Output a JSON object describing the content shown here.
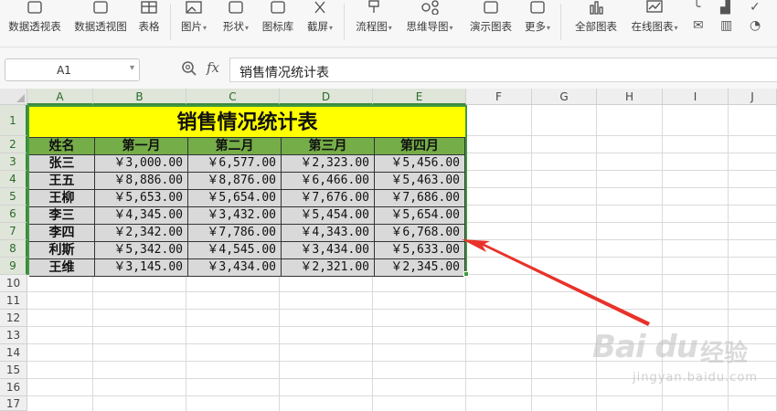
{
  "ribbon": {
    "items": [
      {
        "label": "数据透视表",
        "icon": "pivot-table-icon"
      },
      {
        "label": "数据透视图",
        "icon": "pivot-chart-icon"
      },
      {
        "label": "表格",
        "icon": "table-icon"
      },
      {
        "label": "图片",
        "icon": "picture-icon"
      },
      {
        "label": "形状",
        "icon": "shape-icon"
      },
      {
        "label": "图标库",
        "icon": "icon-library-icon"
      },
      {
        "label": "截屏",
        "icon": "screenshot-icon"
      },
      {
        "label": "流程图",
        "icon": "flowchart-icon"
      },
      {
        "label": "思维导图",
        "icon": "mindmap-icon"
      },
      {
        "label": "演示图表",
        "icon": "demo-chart-icon"
      },
      {
        "label": "更多",
        "icon": "more-icon"
      },
      {
        "label": "全部图表",
        "icon": "all-charts-icon"
      },
      {
        "label": "在线图表",
        "icon": "online-chart-icon"
      }
    ],
    "dropdown_marker": "▾"
  },
  "formula_bar": {
    "name_box": "A1",
    "fx": "fx",
    "content": "销售情况统计表"
  },
  "grid": {
    "columns": [
      "A",
      "B",
      "C",
      "D",
      "E",
      "F",
      "G",
      "H",
      "I",
      "J"
    ],
    "rows": [
      "1",
      "2",
      "3",
      "4",
      "5",
      "6",
      "7",
      "8",
      "9",
      "10",
      "11",
      "12",
      "13",
      "14",
      "15",
      "16",
      "17"
    ]
  },
  "table": {
    "title": "销售情况统计表",
    "headers": [
      "姓名",
      "第一月",
      "第二月",
      "第三月",
      "第四月"
    ],
    "rows": [
      {
        "name": "张三",
        "values": [
          "￥3,000.00",
          "￥6,577.00",
          "￥2,323.00",
          "￥5,456.00"
        ]
      },
      {
        "name": "王五",
        "values": [
          "￥8,886.00",
          "￥8,876.00",
          "￥6,466.00",
          "￥5,463.00"
        ]
      },
      {
        "name": "王柳",
        "values": [
          "￥5,653.00",
          "￥5,654.00",
          "￥7,676.00",
          "￥7,686.00"
        ]
      },
      {
        "name": "李三",
        "values": [
          "￥4,345.00",
          "￥3,432.00",
          "￥5,454.00",
          "￥5,654.00"
        ]
      },
      {
        "name": "李四",
        "values": [
          "￥2,342.00",
          "￥7,786.00",
          "￥4,343.00",
          "￥6,768.00"
        ]
      },
      {
        "name": "利斯",
        "values": [
          "￥5,342.00",
          "￥4,545.00",
          "￥3,434.00",
          "￥5,633.00"
        ]
      },
      {
        "name": "王维",
        "values": [
          "￥3,145.00",
          "￥3,434.00",
          "￥2,321.00",
          "￥2,345.00"
        ]
      }
    ]
  },
  "colors": {
    "title_fill": "#ffff00",
    "header_fill": "#75ad48",
    "body_fill": "#d9d9d9",
    "selection_border": "#3f9a3f",
    "annotation_arrow": "#e8322a"
  },
  "watermark": {
    "logo": "Bai du",
    "cn": "经验",
    "url": "jingyan.baidu.com"
  }
}
